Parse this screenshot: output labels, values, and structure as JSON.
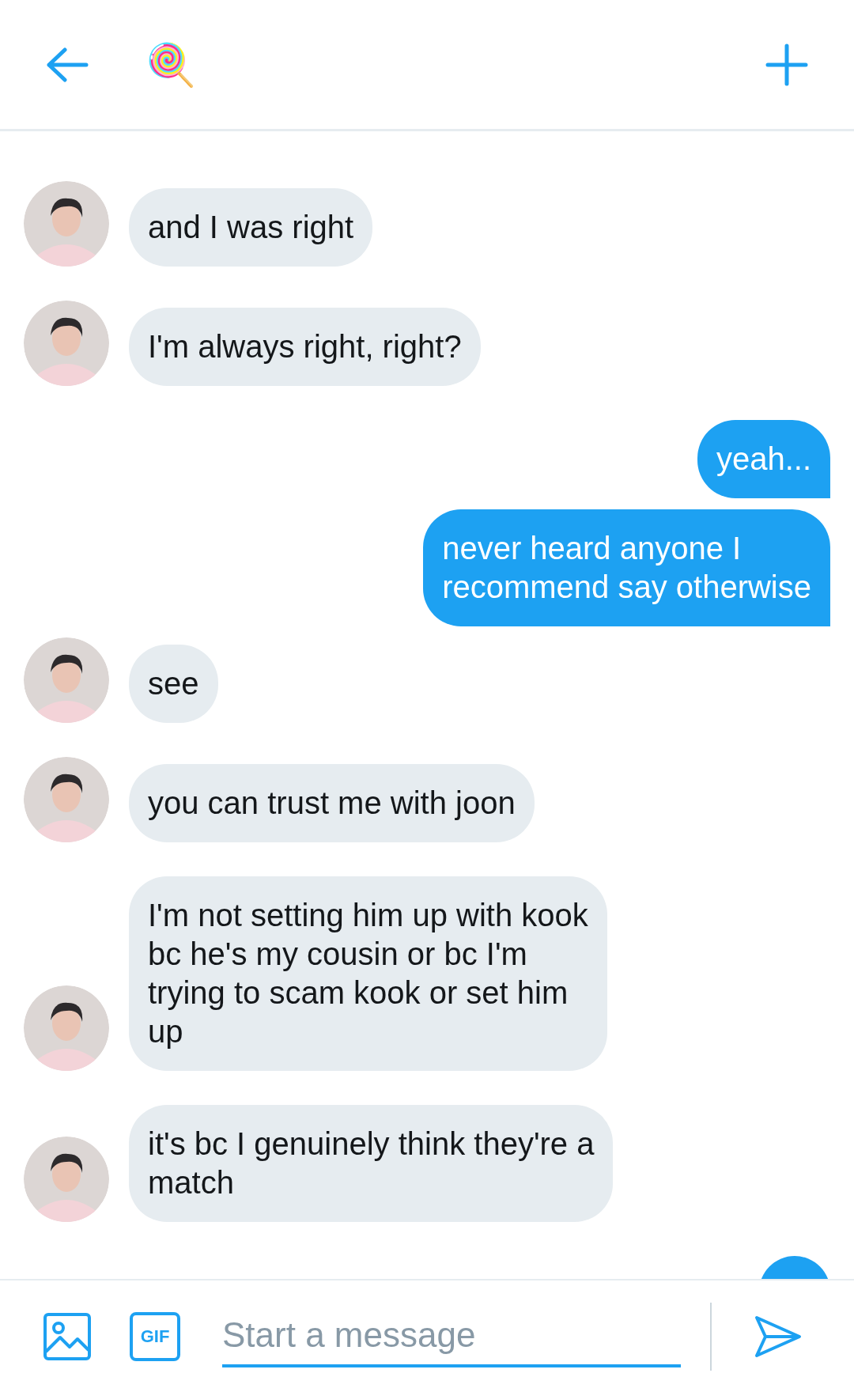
{
  "header": {
    "emoji": "🍭"
  },
  "messages": [
    {
      "kind": "incoming",
      "lines": [
        "and I was right"
      ]
    },
    {
      "kind": "incoming",
      "lines": [
        "I'm always right, right?"
      ]
    },
    {
      "kind": "outgoing",
      "lines": [
        "yeah..."
      ]
    },
    {
      "kind": "outgoing",
      "lines": [
        "never heard anyone I",
        "recommend say otherwise"
      ]
    },
    {
      "kind": "incoming",
      "lines": [
        "see"
      ]
    },
    {
      "kind": "incoming",
      "lines": [
        "you can trust me with joon"
      ]
    },
    {
      "kind": "incoming",
      "lines": [
        "I'm not setting him up with kook",
        "bc he's my cousin or bc I'm",
        "trying to scam kook or set him",
        "up"
      ]
    },
    {
      "kind": "incoming",
      "lines": [
        "it's bc I genuinely think they're a",
        "match"
      ]
    },
    {
      "kind": "partial"
    }
  ],
  "composer": {
    "placeholder": "Start a message",
    "gif_label": "GIF"
  }
}
